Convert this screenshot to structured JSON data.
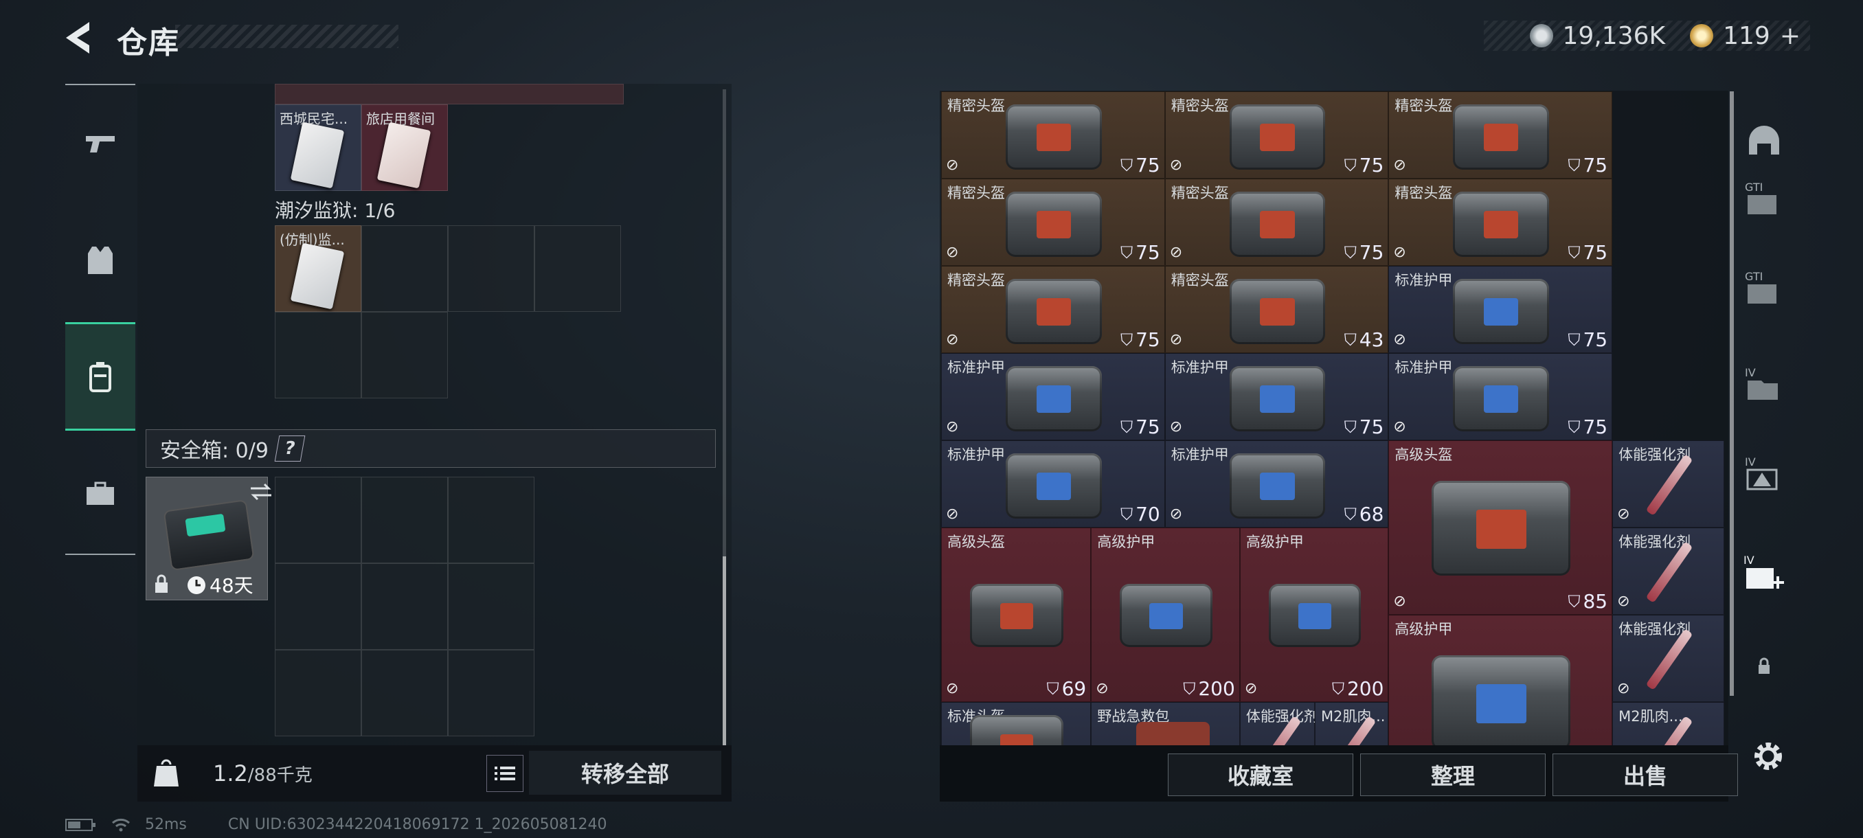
{
  "header": {
    "title": "仓库"
  },
  "currency": {
    "silver": "19,136K",
    "gold": "119",
    "gold_add": "+"
  },
  "left_nav": [
    "weapon-tab",
    "armor-tab",
    "backpack-tab",
    "briefcase-tab"
  ],
  "stash": {
    "row1": [
      {
        "label": "西城民宅...",
        "color": "blue"
      },
      {
        "label": "旅店用餐间",
        "color": "red"
      }
    ],
    "prison_label": "潮汐监狱: 1/6",
    "prison_item": {
      "label": "(仿制)监..."
    },
    "safe_label": "安全箱: 0/9",
    "safe_help": "?",
    "safe_days": "48天"
  },
  "bottom_left": {
    "weight_value": "1.2",
    "weight_unit": "/88千克",
    "transfer_label": "转移全部"
  },
  "items": [
    {
      "name": "精密头盔",
      "dura": "75",
      "color": "brown",
      "kind": "helmet"
    },
    {
      "name": "精密头盔",
      "dura": "75",
      "color": "brown",
      "kind": "helmet"
    },
    {
      "name": "精密头盔",
      "dura": "75",
      "color": "brown",
      "kind": "helmet"
    },
    {
      "name": "精密头盔",
      "dura": "75",
      "color": "brown",
      "kind": "helmet"
    },
    {
      "name": "精密头盔",
      "dura": "75",
      "color": "brown",
      "kind": "helmet"
    },
    {
      "name": "精密头盔",
      "dura": "75",
      "color": "brown",
      "kind": "helmet"
    },
    {
      "name": "精密头盔",
      "dura": "75",
      "color": "brown",
      "kind": "helmet"
    },
    {
      "name": "精密头盔",
      "dura": "43",
      "color": "brown",
      "kind": "helmet"
    },
    {
      "name": "标准护甲",
      "dura": "75",
      "color": "blue",
      "kind": "armor"
    },
    {
      "name": "标准护甲",
      "dura": "75",
      "color": "blue",
      "kind": "armor"
    },
    {
      "name": "标准护甲",
      "dura": "75",
      "color": "blue",
      "kind": "armor"
    },
    {
      "name": "标准护甲",
      "dura": "75",
      "color": "blue",
      "kind": "armor"
    },
    {
      "name": "标准护甲",
      "dura": "70",
      "color": "blue",
      "kind": "armor"
    },
    {
      "name": "标准护甲",
      "dura": "68",
      "color": "blue",
      "kind": "armor"
    },
    {
      "name": "高级头盔",
      "dura": "85",
      "color": "red",
      "kind": "helmet"
    },
    {
      "name": "体能强化剂",
      "dura": "",
      "color": "blue",
      "kind": "syringe"
    },
    {
      "name": "高级头盔",
      "dura": "69",
      "color": "red",
      "kind": "helmet"
    },
    {
      "name": "高级护甲",
      "dura": "200",
      "color": "red",
      "kind": "armor"
    },
    {
      "name": "高级护甲",
      "dura": "200",
      "color": "red",
      "kind": "armor"
    },
    {
      "name": "体能强化剂",
      "dura": "",
      "color": "blue",
      "kind": "syringe"
    },
    {
      "name": "高级护甲",
      "dura": "",
      "color": "red",
      "kind": "armor"
    },
    {
      "name": "体能强化剂",
      "dura": "",
      "color": "blue",
      "kind": "syringe"
    },
    {
      "name": "标准头盔",
      "dura": "",
      "color": "blue",
      "kind": "helmet"
    },
    {
      "name": "野战急救包",
      "dura": "",
      "color": "blue",
      "kind": "medkit"
    },
    {
      "name": "体能强化剂",
      "dura": "",
      "color": "blue",
      "kind": "syringe"
    },
    {
      "name": "M2肌肉...",
      "dura": "",
      "color": "blue",
      "kind": "syringe"
    },
    {
      "name": "M2肌肉...",
      "dura": "",
      "color": "blue",
      "kind": "syringe"
    }
  ],
  "actions": {
    "collection": "收藏室",
    "sort": "整理",
    "sell": "出售"
  },
  "right_nav": [
    "helmet-slot",
    "gti-1",
    "gti-2",
    "iv-folder",
    "iv-map",
    "iv-medkit",
    "lock"
  ],
  "status": {
    "ping": "52ms",
    "uid": "CN UID:6302344220418069172 1_202605081240"
  }
}
